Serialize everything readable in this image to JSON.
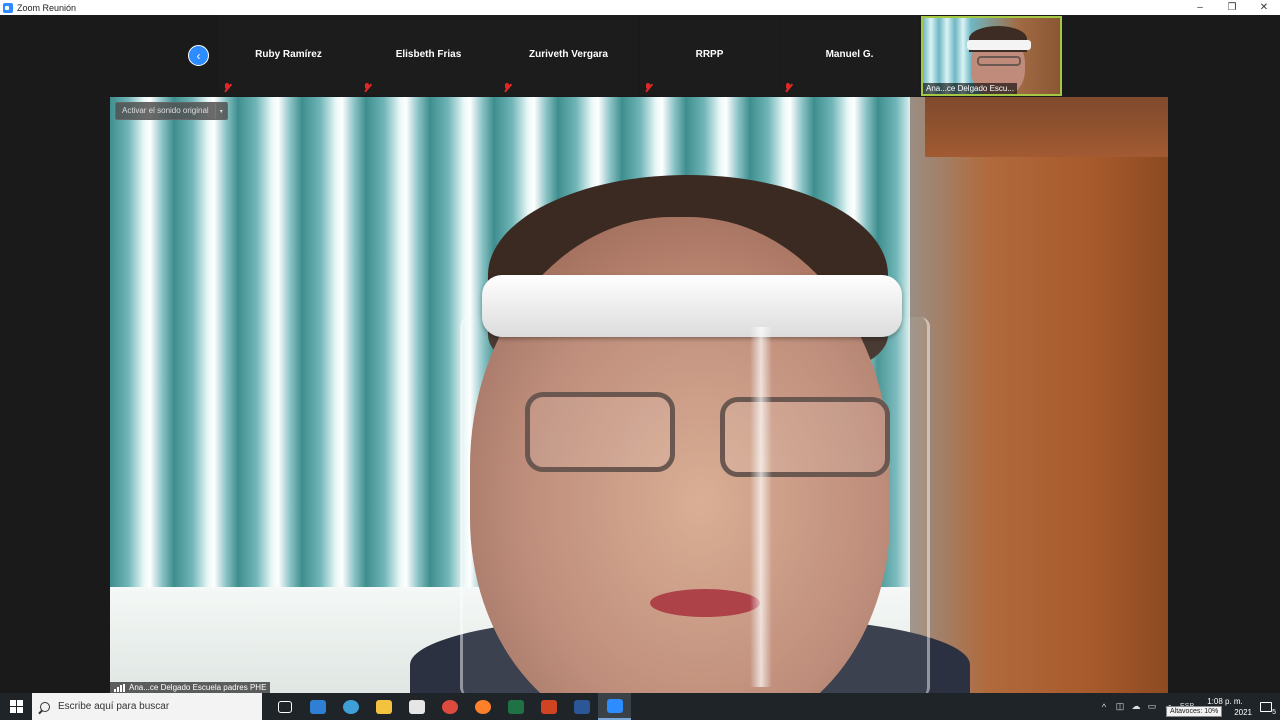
{
  "window": {
    "title": "Zoom Reunión",
    "minimize": "–",
    "restore": "❐",
    "close": "✕"
  },
  "strip": {
    "prev_glyph": "‹",
    "participants": [
      {
        "name": "Ruby Ramírez"
      },
      {
        "name": "Elisbeth Frias"
      },
      {
        "name": "Zuriveth Vergara"
      },
      {
        "name": "RRPP"
      },
      {
        "name": "Manuel G."
      }
    ],
    "video_tile_name": "Ana...ce Delgado Escu..."
  },
  "main_video": {
    "audio_button": "Activar el sonido original",
    "audio_caret": "▾",
    "name": "Ana...ce Delgado Escuela padres PHE"
  },
  "taskbar": {
    "search_placeholder": "Escribe aquí para buscar",
    "apps": [
      {
        "name": "task-view",
        "color": "#ffffff"
      },
      {
        "name": "mail",
        "color": "#2f80d4"
      },
      {
        "name": "edge",
        "color": "#3fa0d8"
      },
      {
        "name": "file-explorer",
        "color": "#f3c23f"
      },
      {
        "name": "store",
        "color": "#e6e6e6"
      },
      {
        "name": "chrome",
        "color": "#dd4b3e"
      },
      {
        "name": "firefox",
        "color": "#ff7f2a"
      },
      {
        "name": "excel",
        "color": "#1f7244"
      },
      {
        "name": "powerpoint",
        "color": "#d04423"
      },
      {
        "name": "word",
        "color": "#2b5797"
      },
      {
        "name": "zoom",
        "color": "#2d8cff"
      }
    ],
    "tray": {
      "chevron": "^",
      "language": "ESP",
      "time": "1:08 p. m.",
      "date": "2021",
      "notifications": "5",
      "volume_tooltip": "Altavoces: 10%"
    }
  }
}
